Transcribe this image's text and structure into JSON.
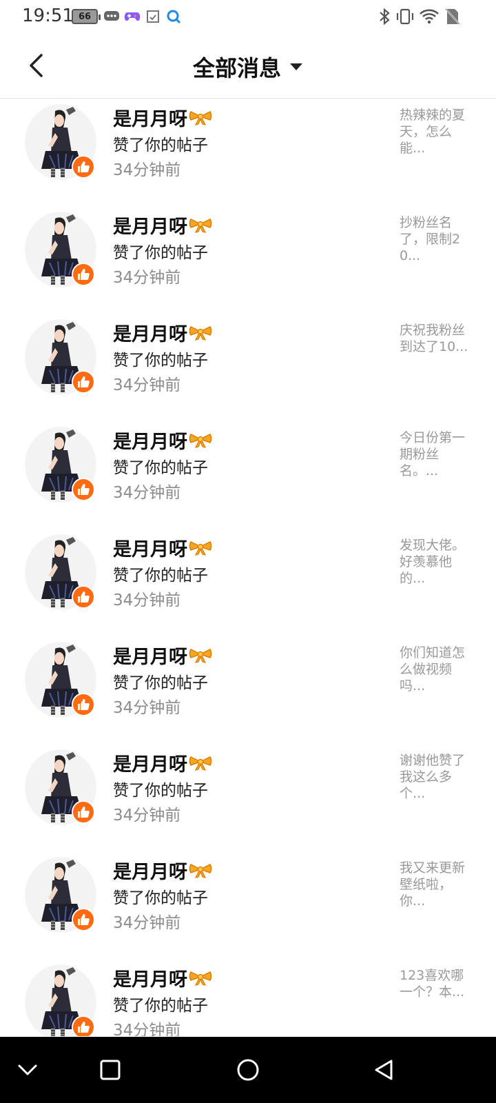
{
  "status_bar": {
    "time": "19:51",
    "battery": "66",
    "icons": [
      "battery-icon",
      "message-icon",
      "game-icon",
      "screenshot-icon",
      "search-app-icon",
      "bluetooth-icon",
      "vibrate-icon",
      "wifi-icon",
      "no-sim-icon"
    ]
  },
  "header": {
    "title": "全部消息",
    "back_icon": "chevron-left-icon",
    "dropdown_icon": "triangle-down-icon"
  },
  "messages": [
    {
      "name": "是月月呀",
      "action": "赞了你的帖子",
      "time": "34分钟前",
      "snippet": "热辣辣的夏天，怎么能..."
    },
    {
      "name": "是月月呀",
      "action": "赞了你的帖子",
      "time": "34分钟前",
      "snippet": "抄粉丝名了，限制20..."
    },
    {
      "name": "是月月呀",
      "action": "赞了你的帖子",
      "time": "34分钟前",
      "snippet": "庆祝我粉丝到达了10..."
    },
    {
      "name": "是月月呀",
      "action": "赞了你的帖子",
      "time": "34分钟前",
      "snippet": "今日份第一期粉丝名。..."
    },
    {
      "name": "是月月呀",
      "action": "赞了你的帖子",
      "time": "34分钟前",
      "snippet": "发现大佬。好羡慕他的..."
    },
    {
      "name": "是月月呀",
      "action": "赞了你的帖子",
      "time": "34分钟前",
      "snippet": "你们知道怎么做视频吗..."
    },
    {
      "name": "是月月呀",
      "action": "赞了你的帖子",
      "time": "34分钟前",
      "snippet": "谢谢他赞了我这么多个..."
    },
    {
      "name": "是月月呀",
      "action": "赞了你的帖子",
      "time": "34分钟前",
      "snippet": "我又来更新壁纸啦，你..."
    },
    {
      "name": "是月月呀",
      "action": "赞了你的帖子",
      "time": "34分钟前",
      "snippet": "123喜欢哪一个？本..."
    }
  ],
  "colors": {
    "accent": "#ff6a13",
    "bow": "#f5a623",
    "muted_text": "#8c8c8c",
    "snippet_text": "#999999"
  },
  "nav_bar": {
    "icons": [
      "collapse-icon",
      "recent-apps-icon",
      "home-icon",
      "back-triangle-icon"
    ]
  }
}
